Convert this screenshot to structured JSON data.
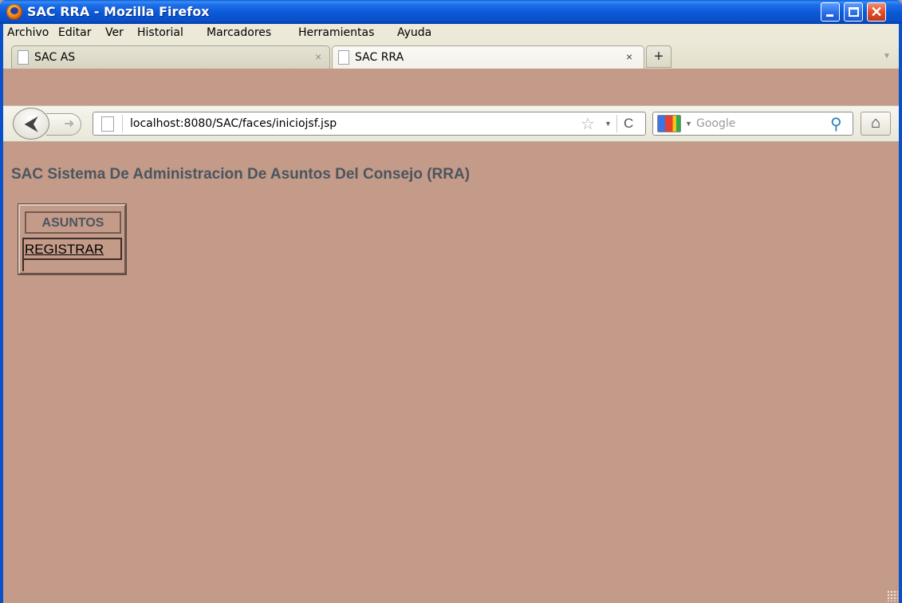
{
  "window": {
    "title": "SAC RRA - Mozilla Firefox",
    "minimize_icon": "minimize-icon",
    "maximize_icon": "maximize-icon",
    "close_glyph": "✕"
  },
  "menubar": {
    "items": [
      {
        "label": "Archivo"
      },
      {
        "label": "Editar"
      },
      {
        "label": "Ver"
      },
      {
        "label": "Historial"
      },
      {
        "label": "Marcadores"
      },
      {
        "label": "Herramientas"
      },
      {
        "label": "Ayuda"
      }
    ]
  },
  "tabs": [
    {
      "label": "SAC AS",
      "close": "×",
      "active": false
    },
    {
      "label": "SAC RRA",
      "close": "×",
      "active": true
    }
  ],
  "new_tab_glyph": "+",
  "navigation": {
    "back_glyph": "⮜",
    "forward_glyph": "➜",
    "url": "localhost:8080/SAC/faces/iniciojsf.jsp",
    "bookmark_star": "☆",
    "reload_glyph": "C",
    "search_placeholder": "Google",
    "search_glyph": "⚲",
    "home_glyph": "⌂"
  },
  "page": {
    "heading": "SAC Sistema De Administracion De Asuntos Del Consejo (RRA)",
    "menu_title": "ASUNTOS",
    "menu_items": [
      {
        "label": "REGISTRAR"
      }
    ]
  },
  "colors": {
    "page_background": "#c49a88",
    "heading_text": "#4a5660",
    "titlebar_blue": "#0a58d6"
  }
}
